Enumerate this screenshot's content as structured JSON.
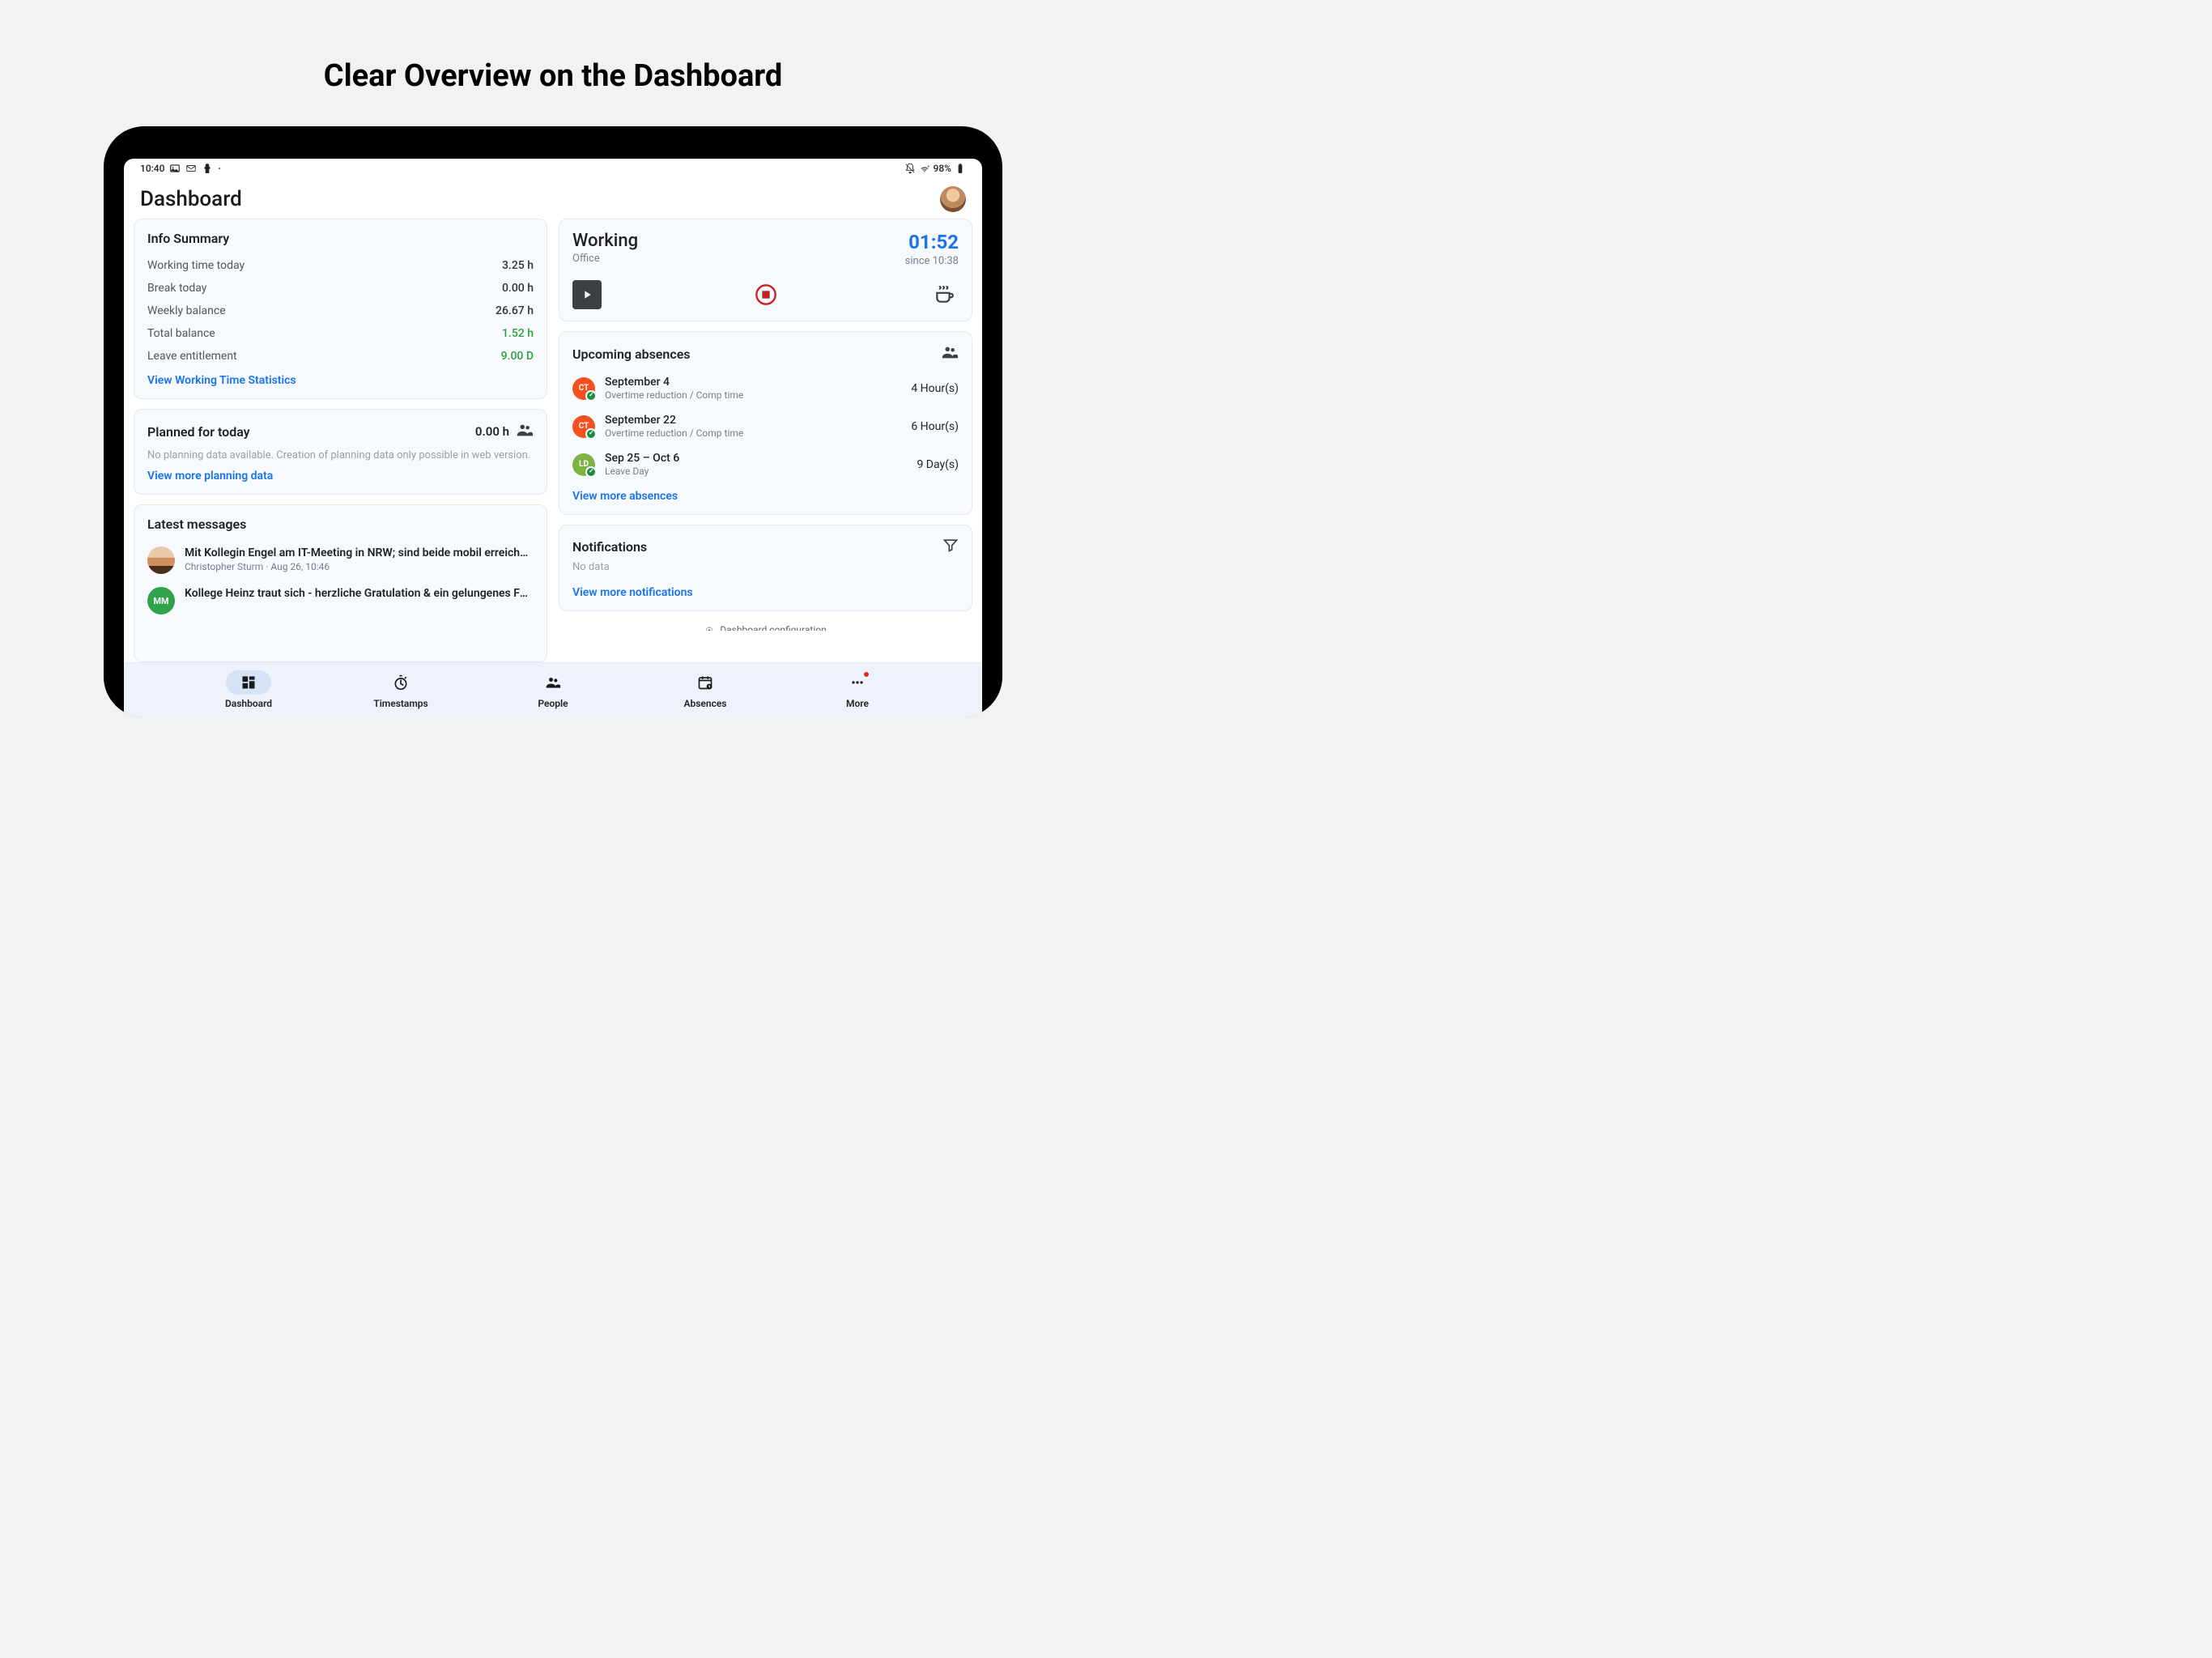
{
  "marketing_title": "Clear Overview on the Dashboard",
  "status_bar": {
    "time": "10:40",
    "battery_text": "98%"
  },
  "header": {
    "title": "Dashboard"
  },
  "info_summary": {
    "title": "Info Summary",
    "rows": [
      {
        "label": "Working time today",
        "value": "3.25 h",
        "green": false
      },
      {
        "label": "Break today",
        "value": "0.00 h",
        "green": false
      },
      {
        "label": "Weekly balance",
        "value": "26.67 h",
        "green": false
      },
      {
        "label": "Total balance",
        "value": "1.52 h",
        "green": true
      },
      {
        "label": "Leave entitlement",
        "value": "9.00 D",
        "green": true
      }
    ],
    "link": "View Working Time Statistics"
  },
  "planned": {
    "title": "Planned for today",
    "hours": "0.00 h",
    "empty_text": "No planning data available. Creation of planning data only possible in web version.",
    "link": "View more planning data"
  },
  "messages": {
    "title": "Latest messages",
    "items": [
      {
        "title": "Mit Kollegin Engel am IT-Meeting in NRW; sind beide mobil erreichbar",
        "meta": "Christopher Sturm · Aug 26, 10:46",
        "avatar": "photo"
      },
      {
        "title": "Kollege Heinz traut sich - herzliche Gratulation & ein gelungenes Fest!",
        "meta": "",
        "avatar": "mm",
        "initials": "MM"
      }
    ]
  },
  "working": {
    "status": "Working",
    "location": "Office",
    "time": "01:52",
    "since": "since 10:38"
  },
  "absences": {
    "title": "Upcoming absences",
    "items": [
      {
        "date": "September 4",
        "type": "Overtime reduction / Comp time",
        "duration": "4 Hour(s)",
        "color": "orange",
        "initials": "CT"
      },
      {
        "date": "September 22",
        "type": "Overtime reduction / Comp time",
        "duration": "6 Hour(s)",
        "color": "orange",
        "initials": "CT"
      },
      {
        "date": "Sep 25 – Oct 6",
        "type": "Leave Day",
        "duration": "9 Day(s)",
        "color": "green",
        "initials": "LD"
      }
    ],
    "link": "View more absences"
  },
  "notifications": {
    "title": "Notifications",
    "no_data": "No data",
    "link": "View more notifications"
  },
  "config_link": "Dashboard configuration",
  "nav": {
    "items": [
      {
        "label": "Dashboard",
        "icon": "dashboard",
        "active": true
      },
      {
        "label": "Timestamps",
        "icon": "stopwatch",
        "active": false
      },
      {
        "label": "People",
        "icon": "people",
        "active": false
      },
      {
        "label": "Absences",
        "icon": "calendar",
        "active": false
      },
      {
        "label": "More",
        "icon": "more",
        "active": false,
        "badge": true
      }
    ]
  }
}
